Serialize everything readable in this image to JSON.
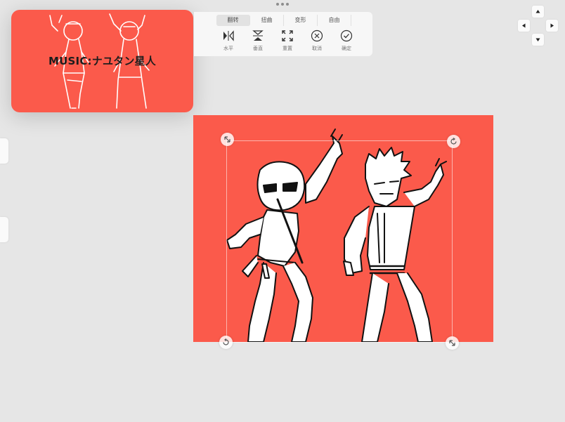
{
  "preview": {
    "title": "MUSIC:ナユタン星人"
  },
  "toolbar": {
    "tabs": [
      {
        "label": "翻转",
        "active": true
      },
      {
        "label": "扭曲",
        "active": false
      },
      {
        "label": "变形",
        "active": false
      },
      {
        "label": "自由",
        "active": false
      }
    ],
    "tools": [
      {
        "label": "水平",
        "icon": "flip-horizontal-icon"
      },
      {
        "label": "垂直",
        "icon": "flip-vertical-icon"
      },
      {
        "label": "重置",
        "icon": "expand-reset-icon"
      },
      {
        "label": "取消",
        "icon": "cancel-x-icon"
      },
      {
        "label": "确定",
        "icon": "confirm-check-icon"
      }
    ]
  },
  "colors": {
    "canvas": "#fb5a4b",
    "background": "#e6e6e6",
    "toolbar": "#f7f7f7"
  },
  "dpad": {
    "keys": [
      "up",
      "left",
      "right",
      "down"
    ]
  },
  "transform_handles": [
    "scale-handle-top-left",
    "rotate-handle-top-right",
    "rotate-handle-bottom-left",
    "scale-handle-bottom-right"
  ]
}
